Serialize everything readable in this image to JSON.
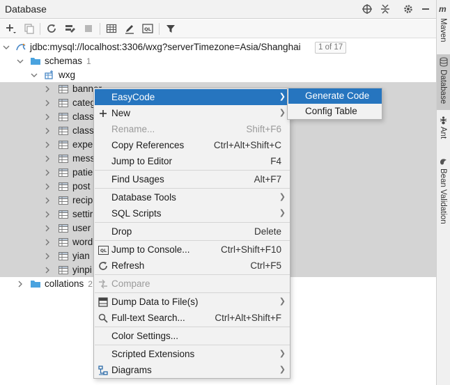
{
  "header": {
    "title": "Database"
  },
  "tree": {
    "connection": {
      "label": "jdbc:mysql://localhost:3306/wxg?serverTimezone=Asia/Shanghai",
      "badge": "1 of 17"
    },
    "schemas": {
      "label": "schemas",
      "count": "1"
    },
    "schema": {
      "label": "wxg"
    },
    "tables": [
      "banner",
      "categ",
      "class",
      "class",
      "expe",
      "mess",
      "patie",
      "post",
      "recip",
      "settir",
      "user",
      "word",
      "yian",
      "yinpi"
    ],
    "collations": {
      "label": "collations",
      "count": "2"
    }
  },
  "context_menu": {
    "items": [
      {
        "label": "EasyCode",
        "shortcut": "",
        "submenu": true,
        "icon": "",
        "highlighted": true,
        "disabled": false
      },
      {
        "label": "New",
        "shortcut": "",
        "submenu": true,
        "icon": "plus-icon",
        "highlighted": false,
        "disabled": false
      },
      {
        "label": "Rename...",
        "shortcut": "Shift+F6",
        "submenu": false,
        "icon": "",
        "highlighted": false,
        "disabled": true
      },
      {
        "label": "Copy References",
        "shortcut": "Ctrl+Alt+Shift+C",
        "submenu": false,
        "icon": "",
        "highlighted": false,
        "disabled": false
      },
      {
        "label": "Jump to Editor",
        "shortcut": "F4",
        "submenu": false,
        "icon": "",
        "highlighted": false,
        "disabled": false
      },
      {
        "label": "Find Usages",
        "shortcut": "Alt+F7",
        "submenu": false,
        "icon": "",
        "highlighted": false,
        "disabled": false
      },
      {
        "label": "Database Tools",
        "shortcut": "",
        "submenu": true,
        "icon": "",
        "highlighted": false,
        "disabled": false
      },
      {
        "label": "SQL Scripts",
        "shortcut": "",
        "submenu": true,
        "icon": "",
        "highlighted": false,
        "disabled": false
      },
      {
        "label": "Drop",
        "shortcut": "Delete",
        "submenu": false,
        "icon": "",
        "highlighted": false,
        "disabled": false
      },
      {
        "label": "Jump to Console...",
        "shortcut": "Ctrl+Shift+F10",
        "submenu": false,
        "icon": "console-icon",
        "highlighted": false,
        "disabled": false
      },
      {
        "label": "Refresh",
        "shortcut": "Ctrl+F5",
        "submenu": false,
        "icon": "refresh-icon",
        "highlighted": false,
        "disabled": false
      },
      {
        "label": "Compare",
        "shortcut": "",
        "submenu": false,
        "icon": "compare-icon",
        "highlighted": false,
        "disabled": true
      },
      {
        "label": "Dump Data to File(s)",
        "shortcut": "",
        "submenu": true,
        "icon": "dump-data-icon",
        "highlighted": false,
        "disabled": false
      },
      {
        "label": "Full-text Search...",
        "shortcut": "Ctrl+Alt+Shift+F",
        "submenu": false,
        "icon": "search-icon",
        "highlighted": false,
        "disabled": false
      },
      {
        "label": "Color Settings...",
        "shortcut": "",
        "submenu": false,
        "icon": "",
        "highlighted": false,
        "disabled": false
      },
      {
        "label": "Scripted Extensions",
        "shortcut": "",
        "submenu": true,
        "icon": "",
        "highlighted": false,
        "disabled": false
      },
      {
        "label": "Diagrams",
        "shortcut": "",
        "submenu": true,
        "icon": "diagram-icon",
        "highlighted": false,
        "disabled": false
      }
    ]
  },
  "submenu": {
    "items": [
      {
        "label": "Generate Code",
        "highlighted": true
      },
      {
        "label": "Config Table",
        "highlighted": false
      }
    ]
  },
  "right_tabs": [
    {
      "label": "Maven",
      "icon": "maven-icon",
      "active": false
    },
    {
      "label": "Database",
      "icon": "database-icon",
      "active": true
    },
    {
      "label": "Ant",
      "icon": "ant-icon",
      "active": false
    },
    {
      "label": "Bean Validation",
      "icon": "bean-validation-icon",
      "active": false
    }
  ],
  "colors": {
    "highlight": "#2675bf",
    "selection": "#d4d4d4",
    "folder": "#4aa3df"
  }
}
